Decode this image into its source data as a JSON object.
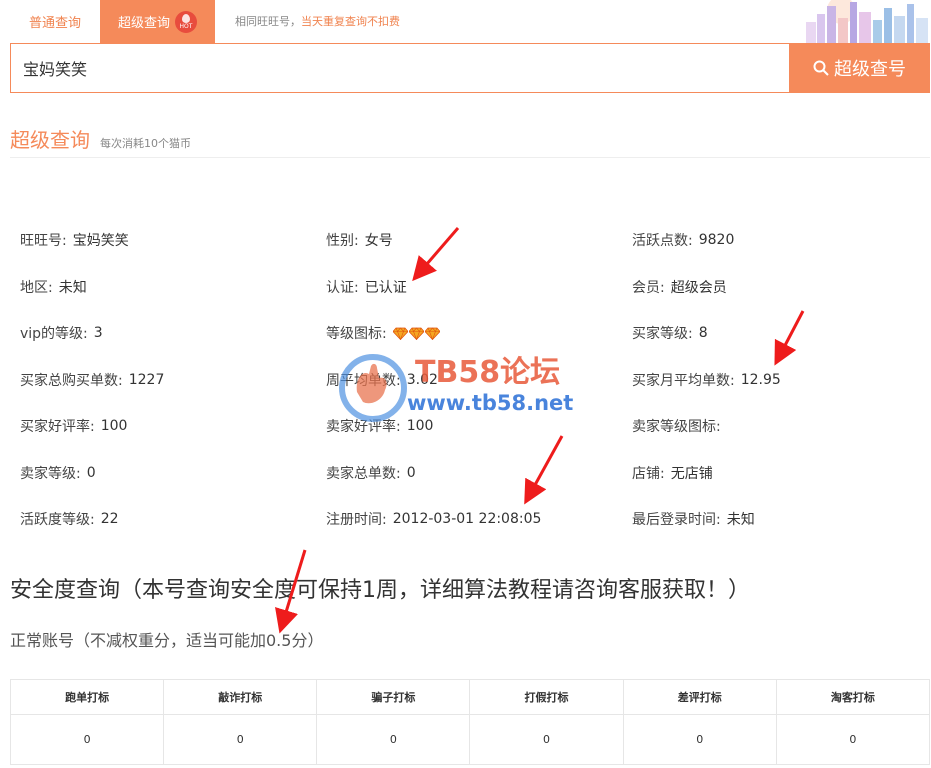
{
  "tabs": [
    {
      "label": "普通查询"
    },
    {
      "label": "超级查询"
    }
  ],
  "hot_badge": "HOT",
  "tip": {
    "normal": "相同旺旺号，",
    "highlight": "当天重复查询不扣费"
  },
  "search": {
    "value": "宝妈笑笑",
    "button_label": "超级查号"
  },
  "section": {
    "title": "超级查询",
    "subtitle": "每次消耗10个猫币"
  },
  "info": {
    "wangwang": {
      "label": "旺旺号:",
      "value": "宝妈笑笑"
    },
    "gender": {
      "label": "性别:",
      "value": "女号"
    },
    "active_points": {
      "label": "活跃点数:",
      "value": "9820"
    },
    "region": {
      "label": "地区:",
      "value": "未知"
    },
    "verified": {
      "label": "认证:",
      "value": "已认证"
    },
    "member": {
      "label": "会员:",
      "value": "超级会员"
    },
    "vip_level": {
      "label": "vip的等级:",
      "value": "3"
    },
    "level_icon": {
      "label": "等级图标:",
      "diamond_count": 3
    },
    "buyer_level": {
      "label": "买家等级:",
      "value": "8"
    },
    "buyer_total_orders": {
      "label": "买家总购买单数:",
      "value": "1227"
    },
    "weekly_avg_orders": {
      "label": "周平均单数:",
      "value": "3.02"
    },
    "buyer_monthly_avg": {
      "label": "买家月平均单数:",
      "value": "12.95"
    },
    "buyer_good_rate": {
      "label": "买家好评率:",
      "value": "100"
    },
    "seller_good_rate": {
      "label": "卖家好评率:",
      "value": "100"
    },
    "seller_level_icon": {
      "label": "卖家等级图标:",
      "value": ""
    },
    "seller_level": {
      "label": "卖家等级:",
      "value": "0"
    },
    "seller_total_orders": {
      "label": "卖家总单数:",
      "value": "0"
    },
    "shop": {
      "label": "店铺:",
      "value": "无店铺"
    },
    "activity_level": {
      "label": "活跃度等级:",
      "value": "22"
    },
    "register_time": {
      "label": "注册时间:",
      "value": "2012-03-01 22:08:05"
    },
    "last_login": {
      "label": "最后登录时间:",
      "value": "未知"
    }
  },
  "safety": {
    "title": "安全度查询（本号查询安全度可保持1周，详细算法教程请咨询客服获取！）",
    "status": "正常账号（不减权重分，适当可能加0.5分）"
  },
  "tags_table": {
    "headers": [
      "跑单打标",
      "敲诈打标",
      "骗子打标",
      "打假打标",
      "差评打标",
      "淘客打标"
    ],
    "values": [
      "0",
      "0",
      "0",
      "0",
      "0",
      "0"
    ]
  },
  "watermark": {
    "line1": "TB58论坛",
    "line2": "www.tb58.net"
  },
  "colors": {
    "accent": "#f58a5a",
    "arrow": "#ee1c1c",
    "watermark_red": "#e85a3a",
    "watermark_blue": "#2a6fd6"
  }
}
